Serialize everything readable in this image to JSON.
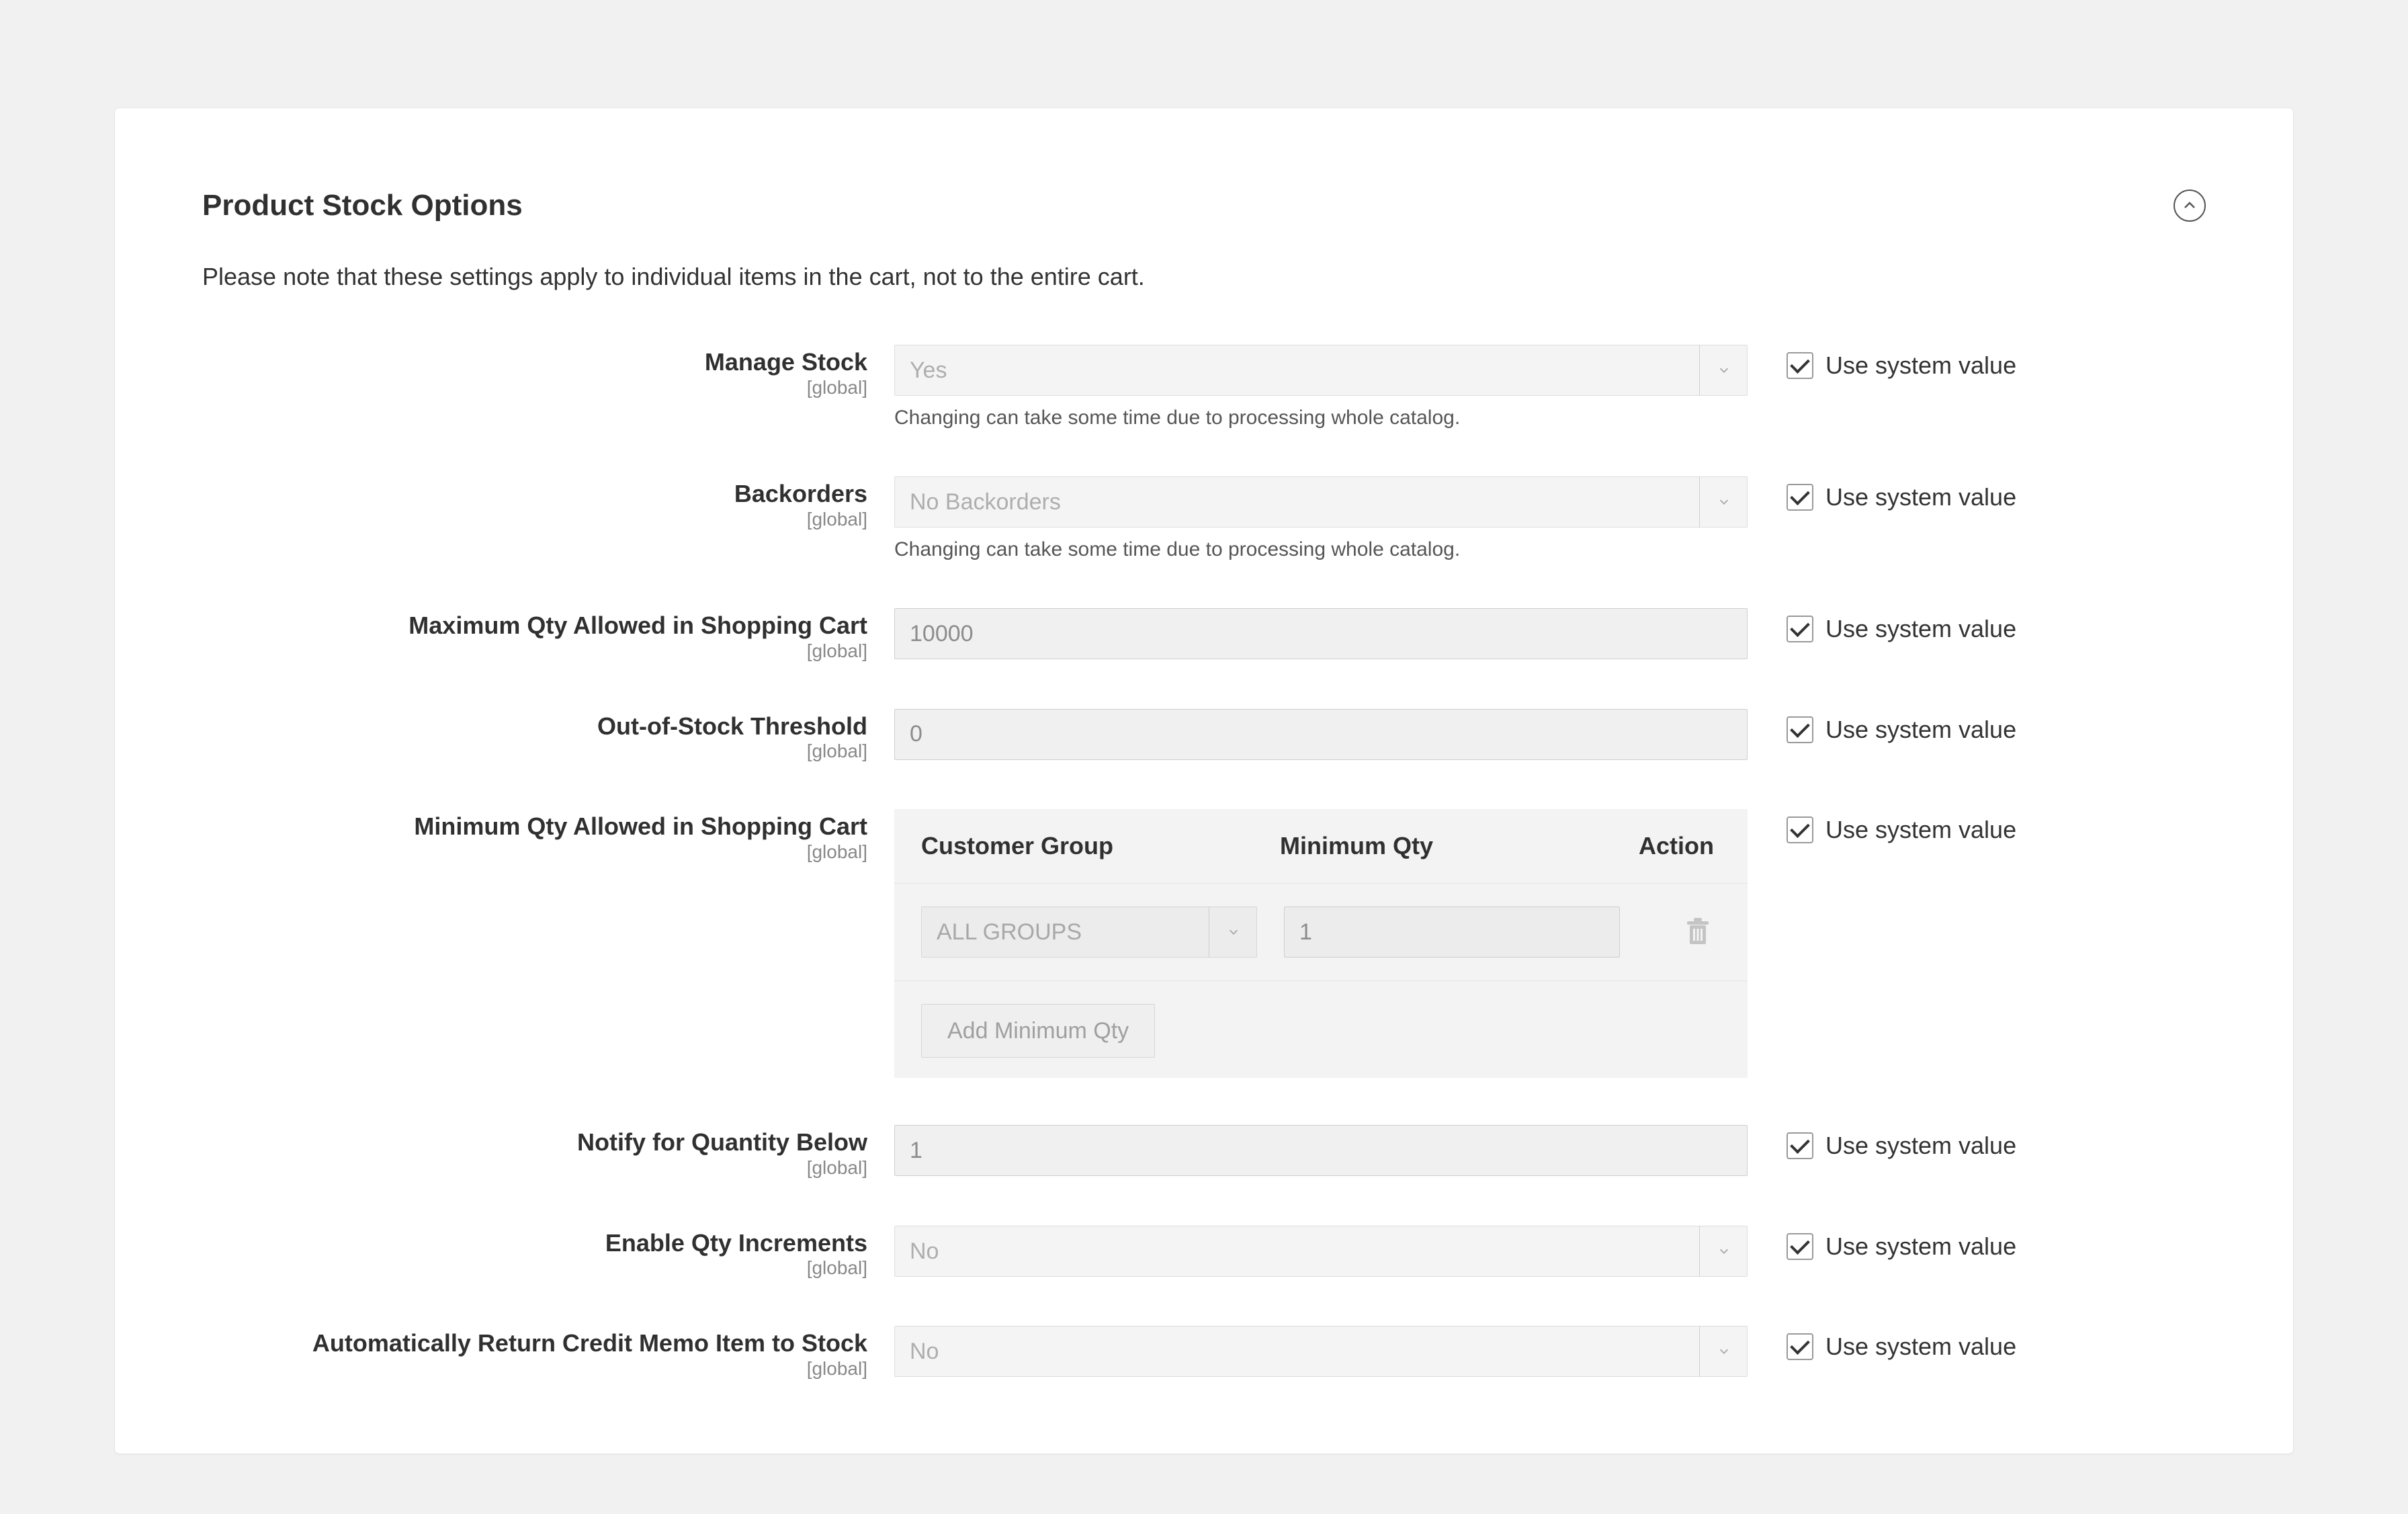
{
  "section": {
    "title": "Product Stock Options",
    "note": "Please note that these settings apply to individual items in the cart, not to the entire cart."
  },
  "common": {
    "scope_label": "[global]",
    "use_system_value": "Use system value",
    "catalog_note": "Changing can take some time due to processing whole catalog."
  },
  "fields": {
    "manage_stock": {
      "label": "Manage Stock",
      "value": "Yes"
    },
    "backorders": {
      "label": "Backorders",
      "value": "No Backorders"
    },
    "max_qty": {
      "label": "Maximum Qty Allowed in Shopping Cart",
      "value": "10000"
    },
    "oos_threshold": {
      "label": "Out-of-Stock Threshold",
      "value": "0"
    },
    "min_qty": {
      "label": "Minimum Qty Allowed in Shopping Cart",
      "table": {
        "headers": {
          "group": "Customer Group",
          "min_qty": "Minimum Qty",
          "action": "Action"
        },
        "row": {
          "group_value": "ALL GROUPS",
          "qty_value": "1"
        },
        "add_button": "Add Minimum Qty"
      }
    },
    "notify_below": {
      "label": "Notify for Quantity Below",
      "value": "1"
    },
    "qty_increments": {
      "label": "Enable Qty Increments",
      "value": "No"
    },
    "auto_return": {
      "label": "Automatically Return Credit Memo Item to Stock",
      "value": "No"
    }
  }
}
